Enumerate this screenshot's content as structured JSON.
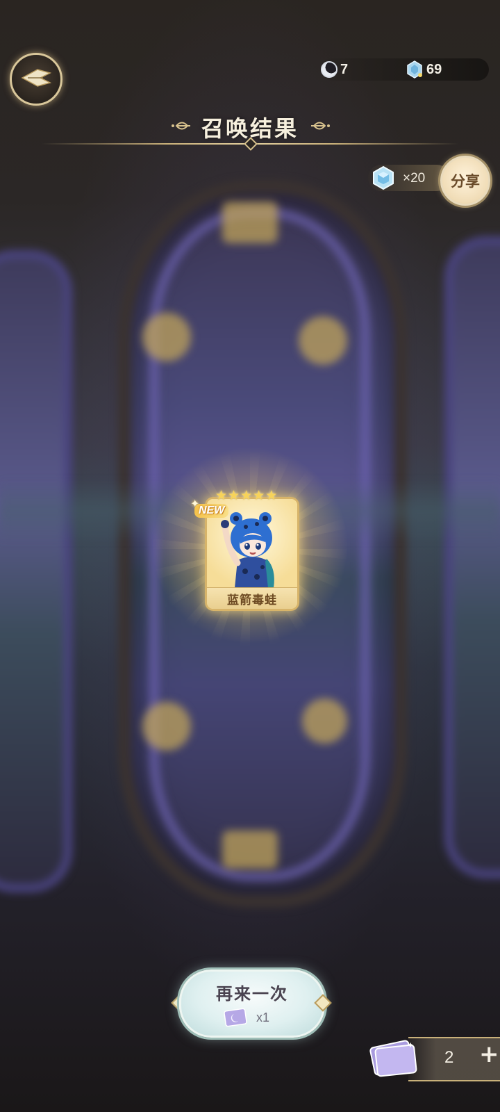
{
  "top_bar": {
    "moon_currency": "7",
    "gem_currency": "69"
  },
  "title": {
    "text": "召唤结果"
  },
  "share": {
    "reward_count": "×20",
    "button_label": "分享"
  },
  "result_card": {
    "name": "蓝箭毒蛙",
    "badge": "NEW",
    "stars": 5
  },
  "again_button": {
    "label": "再来一次",
    "cost": "x1"
  },
  "tickets": {
    "count": "2",
    "add_label": "+"
  },
  "colors": {
    "gold_accent": "#d9c38e",
    "card_bg": "#fbe6a6",
    "button_bg": "#dff0f0"
  }
}
